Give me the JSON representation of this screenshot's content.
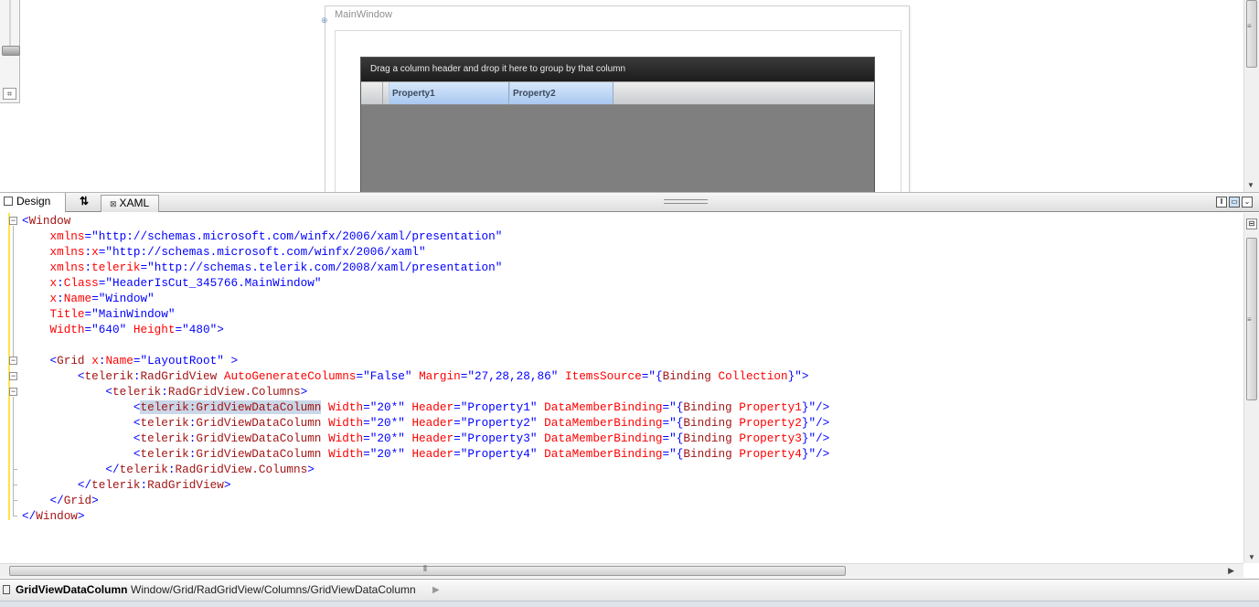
{
  "design_view": {
    "window_title": "MainWindow",
    "grid": {
      "group_panel_text": "Drag a column header and drop it here to group by that column",
      "columns": [
        "Property1",
        "Property2"
      ]
    }
  },
  "tabs": {
    "design_label": "Design",
    "swap_label": "⇅",
    "xaml_label": "XAML"
  },
  "pane_buttons": {
    "vertical_split": "‖",
    "horizontal_split": "▭",
    "collapse": "⌄"
  },
  "xaml_lines": [
    [
      {
        "c": "b",
        "t": "<"
      },
      {
        "c": "m",
        "t": "Window"
      }
    ],
    [
      {
        "c": "",
        "t": "    "
      },
      {
        "c": "r",
        "t": "xmlns"
      },
      {
        "c": "b",
        "t": "=\"http://schemas.microsoft.com/winfx/2006/xaml/presentation\""
      }
    ],
    [
      {
        "c": "",
        "t": "    "
      },
      {
        "c": "r",
        "t": "xmlns"
      },
      {
        "c": "b",
        "t": ":"
      },
      {
        "c": "r",
        "t": "x"
      },
      {
        "c": "b",
        "t": "=\"http://schemas.microsoft.com/winfx/2006/xaml\""
      }
    ],
    [
      {
        "c": "",
        "t": "    "
      },
      {
        "c": "r",
        "t": "xmlns"
      },
      {
        "c": "b",
        "t": ":"
      },
      {
        "c": "r",
        "t": "telerik"
      },
      {
        "c": "b",
        "t": "=\"http://schemas.telerik.com/2008/xaml/presentation\""
      }
    ],
    [
      {
        "c": "",
        "t": "    "
      },
      {
        "c": "r",
        "t": "x"
      },
      {
        "c": "b",
        "t": ":"
      },
      {
        "c": "r",
        "t": "Class"
      },
      {
        "c": "b",
        "t": "=\"HeaderIsCut_345766.MainWindow\""
      }
    ],
    [
      {
        "c": "",
        "t": "    "
      },
      {
        "c": "r",
        "t": "x"
      },
      {
        "c": "b",
        "t": ":"
      },
      {
        "c": "r",
        "t": "Name"
      },
      {
        "c": "b",
        "t": "=\"Window\""
      }
    ],
    [
      {
        "c": "",
        "t": "    "
      },
      {
        "c": "r",
        "t": "Title"
      },
      {
        "c": "b",
        "t": "=\"MainWindow\""
      }
    ],
    [
      {
        "c": "",
        "t": "    "
      },
      {
        "c": "r",
        "t": "Width"
      },
      {
        "c": "b",
        "t": "=\"640\" "
      },
      {
        "c": "r",
        "t": "Height"
      },
      {
        "c": "b",
        "t": "=\"480\">"
      }
    ],
    [
      {
        "c": "",
        "t": ""
      }
    ],
    [
      {
        "c": "",
        "t": "    "
      },
      {
        "c": "b",
        "t": "<"
      },
      {
        "c": "m",
        "t": "Grid"
      },
      {
        "c": "b",
        "t": " "
      },
      {
        "c": "r",
        "t": "x"
      },
      {
        "c": "b",
        "t": ":"
      },
      {
        "c": "r",
        "t": "Name"
      },
      {
        "c": "b",
        "t": "=\"LayoutRoot\" >"
      }
    ],
    [
      {
        "c": "",
        "t": "        "
      },
      {
        "c": "b",
        "t": "<"
      },
      {
        "c": "m",
        "t": "telerik"
      },
      {
        "c": "b",
        "t": ":"
      },
      {
        "c": "m",
        "t": "RadGridView"
      },
      {
        "c": "b",
        "t": " "
      },
      {
        "c": "r",
        "t": "AutoGenerateColumns"
      },
      {
        "c": "b",
        "t": "=\"False\" "
      },
      {
        "c": "r",
        "t": "Margin"
      },
      {
        "c": "b",
        "t": "=\"27,28,28,86\" "
      },
      {
        "c": "r",
        "t": "ItemsSource"
      },
      {
        "c": "b",
        "t": "=\"{"
      },
      {
        "c": "m",
        "t": "Binding"
      },
      {
        "c": "b",
        "t": " "
      },
      {
        "c": "r",
        "t": "Collection"
      },
      {
        "c": "b",
        "t": "}\">"
      }
    ],
    [
      {
        "c": "",
        "t": "            "
      },
      {
        "c": "b",
        "t": "<"
      },
      {
        "c": "m",
        "t": "telerik"
      },
      {
        "c": "b",
        "t": ":"
      },
      {
        "c": "m",
        "t": "RadGridView.Columns"
      },
      {
        "c": "b",
        "t": ">"
      }
    ],
    [
      {
        "c": "",
        "t": "                "
      },
      {
        "c": "b",
        "t": "<"
      },
      {
        "c": "mh",
        "t": "telerik:GridViewDataColumn"
      },
      {
        "c": "b",
        "t": " "
      },
      {
        "c": "r",
        "t": "Width"
      },
      {
        "c": "b",
        "t": "=\"20*\" "
      },
      {
        "c": "r",
        "t": "Header"
      },
      {
        "c": "b",
        "t": "=\"Property1\" "
      },
      {
        "c": "r",
        "t": "DataMemberBinding"
      },
      {
        "c": "b",
        "t": "=\"{"
      },
      {
        "c": "m",
        "t": "Binding"
      },
      {
        "c": "b",
        "t": " "
      },
      {
        "c": "r",
        "t": "Property1"
      },
      {
        "c": "b",
        "t": "}\"/>"
      }
    ],
    [
      {
        "c": "",
        "t": "                "
      },
      {
        "c": "b",
        "t": "<"
      },
      {
        "c": "m",
        "t": "telerik"
      },
      {
        "c": "b",
        "t": ":"
      },
      {
        "c": "m",
        "t": "GridViewDataColumn"
      },
      {
        "c": "b",
        "t": " "
      },
      {
        "c": "r",
        "t": "Width"
      },
      {
        "c": "b",
        "t": "=\"20*\" "
      },
      {
        "c": "r",
        "t": "Header"
      },
      {
        "c": "b",
        "t": "=\"Property2\" "
      },
      {
        "c": "r",
        "t": "DataMemberBinding"
      },
      {
        "c": "b",
        "t": "=\"{"
      },
      {
        "c": "m",
        "t": "Binding"
      },
      {
        "c": "b",
        "t": " "
      },
      {
        "c": "r",
        "t": "Property2"
      },
      {
        "c": "b",
        "t": "}\"/>"
      }
    ],
    [
      {
        "c": "",
        "t": "                "
      },
      {
        "c": "b",
        "t": "<"
      },
      {
        "c": "m",
        "t": "telerik"
      },
      {
        "c": "b",
        "t": ":"
      },
      {
        "c": "m",
        "t": "GridViewDataColumn"
      },
      {
        "c": "b",
        "t": " "
      },
      {
        "c": "r",
        "t": "Width"
      },
      {
        "c": "b",
        "t": "=\"20*\" "
      },
      {
        "c": "r",
        "t": "Header"
      },
      {
        "c": "b",
        "t": "=\"Property3\" "
      },
      {
        "c": "r",
        "t": "DataMemberBinding"
      },
      {
        "c": "b",
        "t": "=\"{"
      },
      {
        "c": "m",
        "t": "Binding"
      },
      {
        "c": "b",
        "t": " "
      },
      {
        "c": "r",
        "t": "Property3"
      },
      {
        "c": "b",
        "t": "}\"/>"
      }
    ],
    [
      {
        "c": "",
        "t": "                "
      },
      {
        "c": "b",
        "t": "<"
      },
      {
        "c": "m",
        "t": "telerik"
      },
      {
        "c": "b",
        "t": ":"
      },
      {
        "c": "m",
        "t": "GridViewDataColumn"
      },
      {
        "c": "b",
        "t": " "
      },
      {
        "c": "r",
        "t": "Width"
      },
      {
        "c": "b",
        "t": "=\"20*\" "
      },
      {
        "c": "r",
        "t": "Header"
      },
      {
        "c": "b",
        "t": "=\"Property4\" "
      },
      {
        "c": "r",
        "t": "DataMemberBinding"
      },
      {
        "c": "b",
        "t": "=\"{"
      },
      {
        "c": "m",
        "t": "Binding"
      },
      {
        "c": "b",
        "t": " "
      },
      {
        "c": "r",
        "t": "Property4"
      },
      {
        "c": "b",
        "t": "}\"/>"
      }
    ],
    [
      {
        "c": "",
        "t": "            "
      },
      {
        "c": "b",
        "t": "</"
      },
      {
        "c": "m",
        "t": "telerik"
      },
      {
        "c": "b",
        "t": ":"
      },
      {
        "c": "m",
        "t": "RadGridView.Columns"
      },
      {
        "c": "b",
        "t": ">"
      }
    ],
    [
      {
        "c": "",
        "t": "        "
      },
      {
        "c": "b",
        "t": "</"
      },
      {
        "c": "m",
        "t": "telerik"
      },
      {
        "c": "b",
        "t": ":"
      },
      {
        "c": "m",
        "t": "RadGridView"
      },
      {
        "c": "b",
        "t": ">"
      }
    ],
    [
      {
        "c": "",
        "t": "    "
      },
      {
        "c": "b",
        "t": "</"
      },
      {
        "c": "m",
        "t": "Grid"
      },
      {
        "c": "b",
        "t": ">"
      }
    ],
    [
      {
        "c": "b",
        "t": "</"
      },
      {
        "c": "m",
        "t": "Window"
      },
      {
        "c": "b",
        "t": ">"
      }
    ]
  ],
  "status_bar": {
    "current_element": "GridViewDataColumn",
    "path": "Window/Grid/RadGridView/Columns/GridViewDataColumn",
    "arrow": "▶"
  },
  "colors": {
    "xaml_markup": "#a31515",
    "xaml_attribute": "#ff0000",
    "xaml_value": "#0000ff",
    "grid_header_selected": "#a8c8f0",
    "group_panel": "#1c1c1c"
  },
  "icons": {
    "design_tab": "design-view-icon",
    "xaml_tab": "xaml-view-icon",
    "swap": "swap-panes-icon",
    "zoom_fit": "zoom-fit-icon"
  }
}
